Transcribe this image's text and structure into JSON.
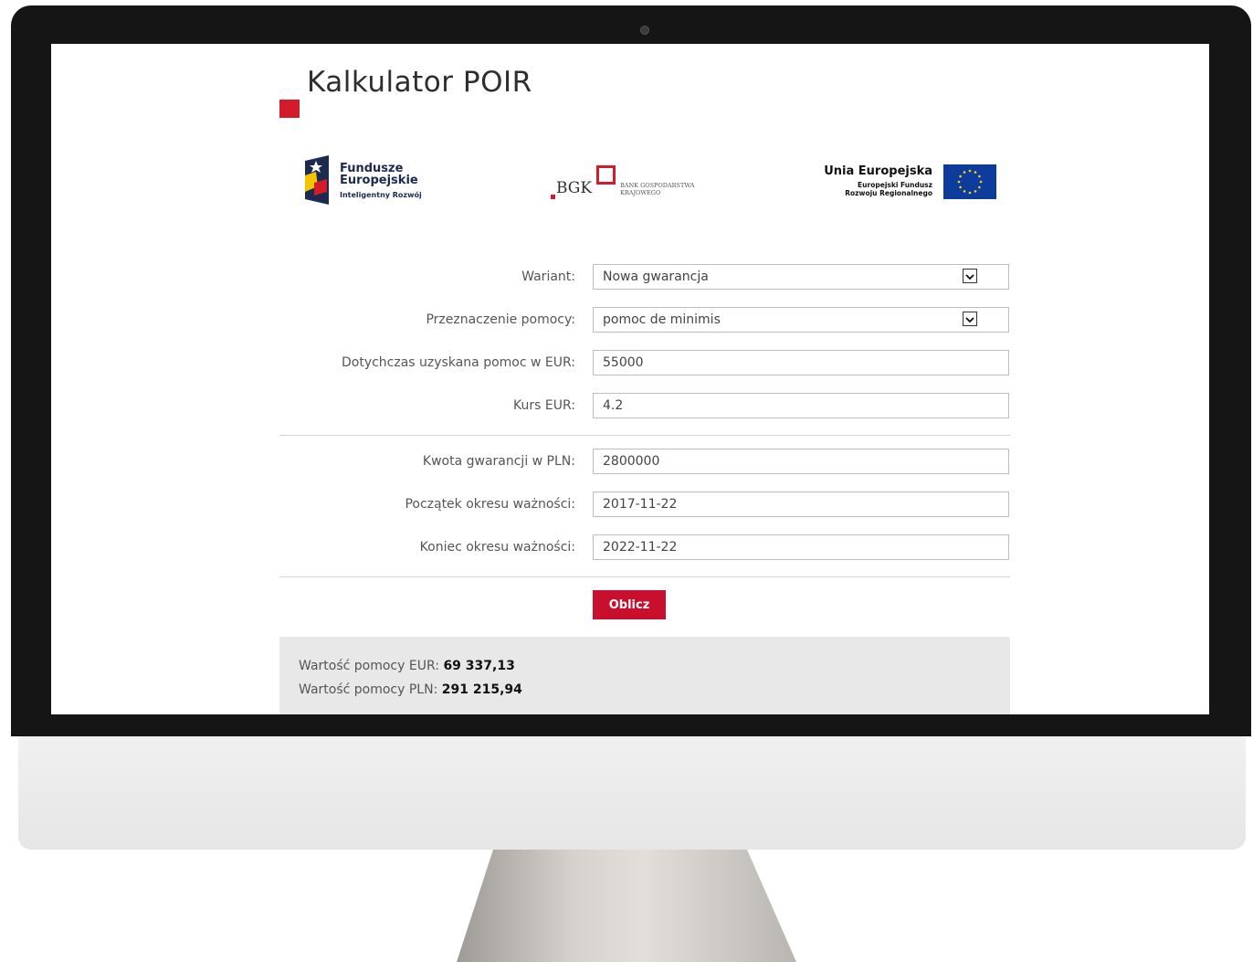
{
  "page": {
    "title": "Kalkulator POIR"
  },
  "logos": {
    "fe_name_line1": "Fundusze",
    "fe_name_line2": "Europejskie",
    "fe_sub": "Inteligentny Rozwój",
    "bgk_text": "BGK",
    "bgk_bank_line1": "BANK GOSPODARSTWA",
    "bgk_bank_line2": "KRAJOWEGO",
    "ue_title": "Unia Europejska",
    "ue_sub_line1": "Europejski Fundusz",
    "ue_sub_line2": "Rozwoju Regionalnego"
  },
  "form": {
    "wariant_label": "Wariant:",
    "wariant_value": "Nowa gwarancja",
    "przeznaczenie_label": "Przeznaczenie pomocy:",
    "przeznaczenie_value": "pomoc de minimis",
    "pomoc_label": "Dotychczas uzyskana pomoc w EUR:",
    "pomoc_value": "55000",
    "kurs_label": "Kurs EUR:",
    "kurs_value": "4.2",
    "kwota_label": "Kwota gwarancji w PLN:",
    "kwota_value": "2800000",
    "poczatek_label": "Początek okresu ważności:",
    "poczatek_value": "2017-11-22",
    "koniec_label": "Koniec okresu ważności:",
    "koniec_value": "2022-11-22",
    "submit_label": "Oblicz"
  },
  "results": {
    "eur_label": "Wartość pomocy EUR:",
    "eur_value": "69 337,13",
    "pln_label": "Wartość pomocy PLN:",
    "pln_value": "291 215,94"
  },
  "colors": {
    "accent": "#d41b2c",
    "button": "#c8102e",
    "eu_flag": "#0e3c9c"
  }
}
